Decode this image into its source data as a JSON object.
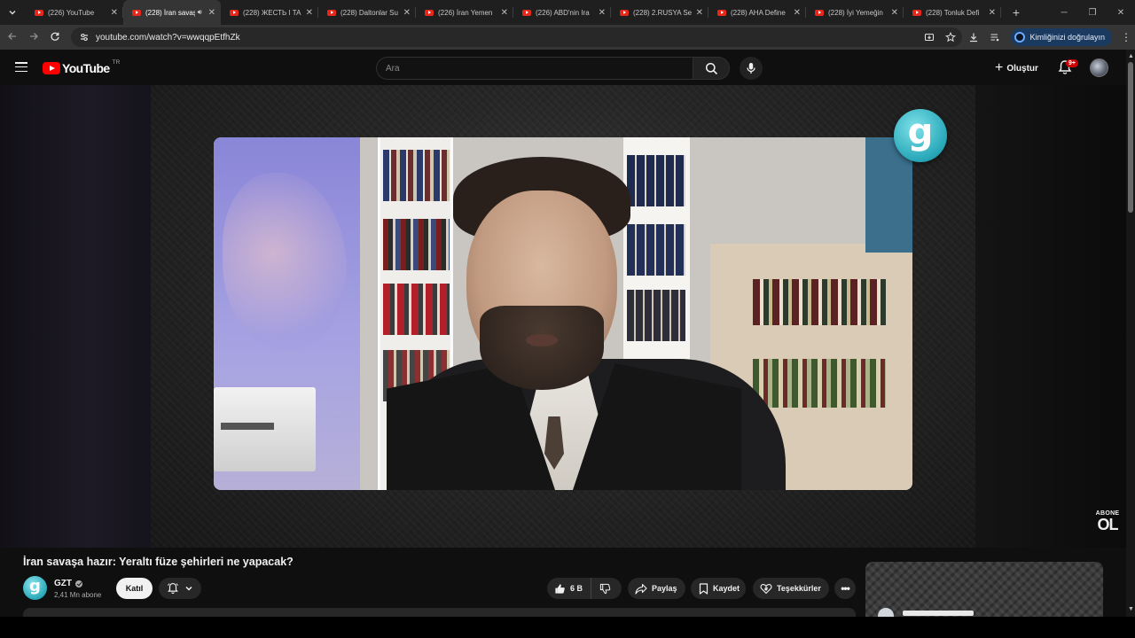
{
  "browser": {
    "tabs": [
      {
        "title": "(226) YouTube",
        "active": false
      },
      {
        "title": "(228) İran savaşa",
        "active": true,
        "audio": true
      },
      {
        "title": "(228) ЖЕСТЬ I TA",
        "active": false
      },
      {
        "title": "(228) Daltonlar Su",
        "active": false
      },
      {
        "title": "(226) İran Yemen",
        "active": false
      },
      {
        "title": "(226) ABD'nin Ira",
        "active": false
      },
      {
        "title": "(228) 2.RUSYA Se",
        "active": false
      },
      {
        "title": "(228) AHA Define",
        "active": false
      },
      {
        "title": "(228) İyi Yemeğin",
        "active": false
      },
      {
        "title": "(228) Tonluk Defi",
        "active": false
      }
    ],
    "url": "youtube.com/watch?v=wwqqpEtfhZk",
    "profile_chip": "Kimliğinizi doğrulayın"
  },
  "youtube": {
    "logo_text": "YouTube",
    "country_code": "TR",
    "search_placeholder": "Ara",
    "create_label": "Oluştur",
    "notification_badge": "9+"
  },
  "player": {
    "watermark_letter": "g",
    "subscribe_overlay_top": "ABONE",
    "subscribe_overlay_bottom": "OL"
  },
  "video": {
    "title": "İran savaşa hazır: Yeraltı füze şehirleri ne yapacak?",
    "channel": {
      "avatar_letter": "g",
      "name": "GZT",
      "subscribers": "2,41 Mn abone",
      "join_label": "Katıl"
    },
    "actions": {
      "likes": "6 B",
      "share_label": "Paylaş",
      "save_label": "Kaydet",
      "thanks_label": "Teşekkürler"
    }
  },
  "icons": {
    "tab_search": "chevron-down-icon",
    "back": "arrow-left-icon",
    "forward": "arrow-right-icon",
    "reload": "reload-icon",
    "site_info": "tune-icon",
    "install": "install-icon",
    "bookmark": "star-icon",
    "download": "download-icon",
    "menu": "kebab-icon"
  },
  "colors": {
    "yt_red": "#ff0000",
    "background": "#0f0f0f",
    "chip_bg": "#272727",
    "accent_teal": "#27a7b8"
  }
}
